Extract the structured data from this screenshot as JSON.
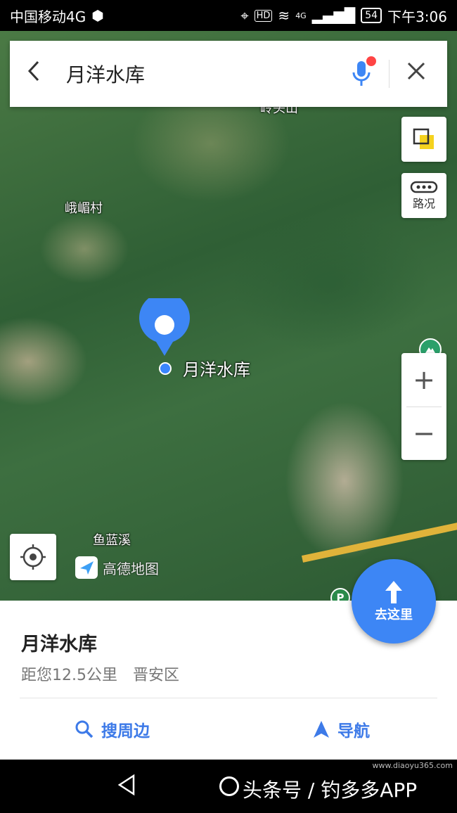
{
  "status_bar": {
    "carrier": "中国移动4G",
    "hd": "HD",
    "network": "4G",
    "battery": "54",
    "time": "下午3:06"
  },
  "search": {
    "query": "月洋水库"
  },
  "map": {
    "labels": {
      "village": "峨嵋村",
      "stream": "鱼蓝溪",
      "top_cut": "岭头山"
    },
    "poi_label": "月洋水库",
    "traffic_label": "路况",
    "logo_text": "高德地图",
    "parking_badge": "P",
    "zoom_in": "+",
    "zoom_out": "−"
  },
  "go_button": {
    "label": "去这里"
  },
  "place": {
    "name": "月洋水库",
    "distance": "距您12.5公里",
    "district": "晋安区"
  },
  "actions": {
    "nearby": "搜周边",
    "navigate": "导航"
  },
  "watermark": {
    "text": "头条号 / 钓多多APP",
    "url": "www.diaoyu365.com"
  },
  "colors": {
    "accent": "#3d86f5",
    "mic_dot": "#ff4444",
    "layers": "#f5d21e"
  }
}
